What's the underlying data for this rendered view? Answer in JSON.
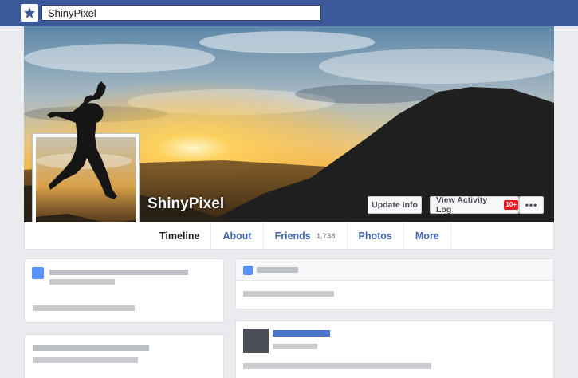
{
  "topbar": {
    "logo_icon": "star-icon",
    "search_value": "ShinyPixel"
  },
  "profile": {
    "name": "ShinyPixel",
    "update_info_label": "Update Info",
    "activity_log_label": "View Activity Log",
    "activity_badge": "10+",
    "more_label": "•••"
  },
  "tabs": [
    {
      "label": "Timeline",
      "active": true
    },
    {
      "label": "About"
    },
    {
      "label": "Friends",
      "count": "1,738"
    },
    {
      "label": "Photos"
    },
    {
      "label": "More"
    }
  ],
  "colors": {
    "brand": "#3b5998",
    "link": "#4267b2",
    "badge": "#e41b23",
    "placeholder_blue": "#5890ff"
  }
}
